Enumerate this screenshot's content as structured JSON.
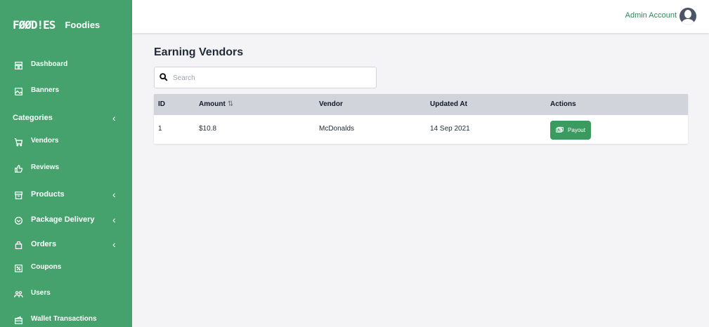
{
  "brand": {
    "logo_text": "FØØD!ES",
    "name": "Foodies"
  },
  "header": {
    "account_label": "Admin Account"
  },
  "sidebar": {
    "items": [
      {
        "label": "Dashboard",
        "icon": "dashboard-icon"
      },
      {
        "label": "Banners",
        "icon": "image-icon"
      },
      {
        "label": "Categories",
        "icon": "",
        "chevron": "‹"
      },
      {
        "label": "Vendors",
        "icon": "cart-icon"
      },
      {
        "label": "Reviews",
        "icon": "thumbs-up-icon"
      },
      {
        "label": "Products",
        "icon": "archive-icon",
        "chevron": "‹"
      },
      {
        "label": "Package Delivery",
        "icon": "package-icon",
        "chevron": "‹"
      },
      {
        "label": "Orders",
        "icon": "bag-icon",
        "chevron": "‹"
      },
      {
        "label": "Coupons",
        "icon": "coupon-icon"
      },
      {
        "label": "Users",
        "icon": "users-icon"
      },
      {
        "label": "Wallet Transactions",
        "icon": "wallet-icon"
      }
    ]
  },
  "main": {
    "title": "Earning Vendors",
    "search": {
      "placeholder": "Search",
      "value": ""
    },
    "table": {
      "headers": [
        "ID",
        "Amount",
        "Vendor",
        "Updated At",
        "Actions"
      ],
      "sort_indicator": "⇅",
      "rows": [
        {
          "id": "1",
          "amount": "$10.8",
          "vendor": "McDonalds",
          "updated_at": "14 Sep 2021",
          "action_label": "Payout"
        }
      ]
    }
  },
  "colors": {
    "sidebar": "#45a26c",
    "accent": "#3a9a60",
    "header_row": "#d1d5db"
  }
}
